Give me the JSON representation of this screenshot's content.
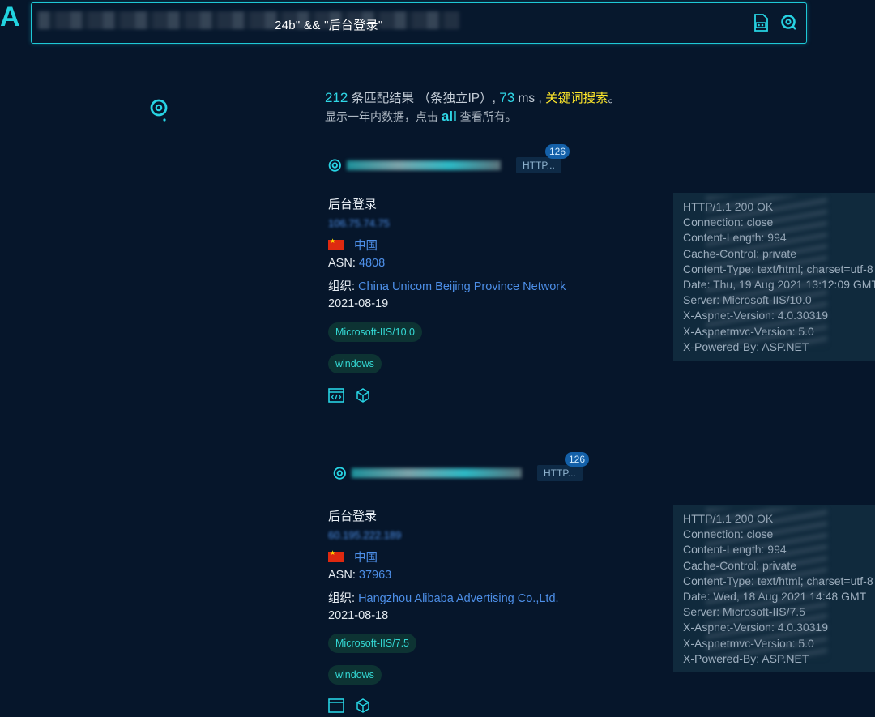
{
  "app": {
    "logo": "A"
  },
  "search": {
    "query": "▪_                                                                                                                        ",
    "query_visible_tail": "24b\" && \"后台登录\"",
    "icons": [
      "image-search-icon",
      "search-icon"
    ]
  },
  "summary": {
    "count": "212",
    "count_suffix": " 条匹配结果 （条独立IP）,",
    "ms": "73",
    "ms_suffix": " ms ,",
    "keyword_search": "关键词搜索",
    "period": "。",
    "line2_prefix": "显示一年内数据，点击 ",
    "line2_link": "all",
    "line2_suffix": " 查看所有。"
  },
  "results": [
    {
      "ip": "106.7",
      "tag": "HTTP...",
      "count": "126",
      "title": "后台登录",
      "host": "106.75.74.75",
      "country": "中国",
      "asn_label": "ASN:",
      "asn": "4808",
      "org_label": "组织:",
      "org": "China Unicom Beijing Province Network",
      "date": "2021-08-19",
      "chips": [
        "Microsoft-IIS/10.0",
        "windows"
      ],
      "headers": [
        "HTTP/1.1 200 OK",
        "Connection: close",
        "Content-Length: 994",
        "Cache-Control: private",
        "Content-Type: text/html; charset=utf-8",
        "Date: Thu, 19 Aug 2021 13:12:09 GMT",
        "Server: Microsoft-IIS/10.0",
        "X-Aspnet-Version: 4.0.30319",
        "X-Aspnetmvc-Version: 5.0",
        "X-Powered-By: ASP.NET"
      ]
    },
    {
      "ip": "60.195.222.189",
      "tag": "HTTP...",
      "count": "126",
      "title": "后台登录",
      "host": "60.195.222.189",
      "country": "中国",
      "asn_label": "ASN:",
      "asn": "37963",
      "org_label": "组织:",
      "org": "Hangzhou Alibaba Advertising Co.,Ltd.",
      "date": "2021-08-18",
      "chips": [
        "Microsoft-IIS/7.5",
        "windows"
      ],
      "headers": [
        "HTTP/1.1 200 OK",
        "Connection: close",
        "Content-Length: 994",
        "Cache-Control: private",
        "Content-Type: text/html; charset=utf-8",
        "Date: Wed, 18 Aug 2021 14:48 GMT",
        "Server: Microsoft-IIS/7.5",
        "X-Aspnet-Version: 4.0.30319",
        "X-Aspnetmvc-Version: 5.0",
        "X-Powered-By: ASP.NET"
      ]
    }
  ],
  "colors": {
    "accent": "#27d3e3",
    "link": "#4d8fe8",
    "keyword": "#ffe82b",
    "background": "#06162b"
  }
}
